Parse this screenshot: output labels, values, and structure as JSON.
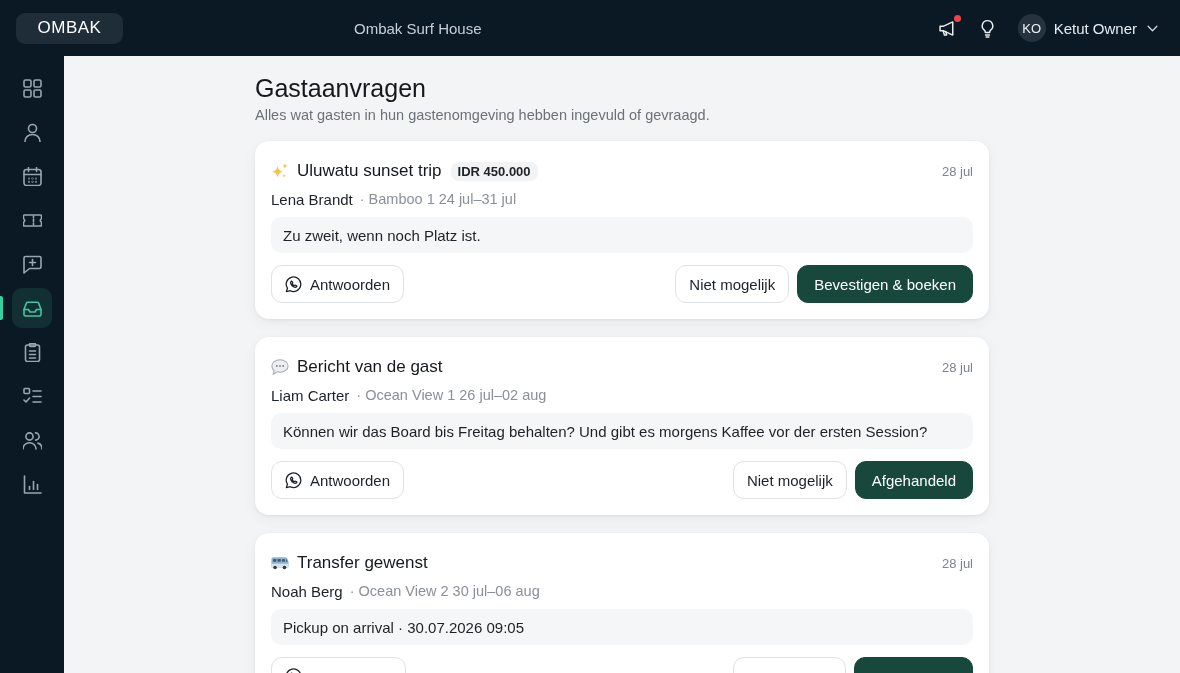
{
  "header": {
    "logo": "OMBAK",
    "property": "Ombak Surf House",
    "notifications_unread": true,
    "user": {
      "initials": "KO",
      "name": "Ketut Owner"
    }
  },
  "sidebar": {
    "items": [
      {
        "selected": false
      },
      {
        "selected": false
      },
      {
        "selected": false
      },
      {
        "selected": false
      },
      {
        "selected": false
      },
      {
        "selected": true
      },
      {
        "selected": false
      },
      {
        "selected": false
      },
      {
        "selected": false
      },
      {
        "selected": false
      }
    ]
  },
  "page": {
    "title": "Gastaanvragen",
    "subtitle": "Alles wat gasten in hun gastenomgeving hebben ingevuld of gevraagd."
  },
  "requests": [
    {
      "kind": "excursion",
      "title": "Uluwatu sunset trip",
      "price": "IDR 450.000",
      "date": "28 jul",
      "guest": "Lena Brandt",
      "details": "· Bamboo 1 24 jul–31 jul",
      "message": "Zu zweit, wenn noch Platz ist.",
      "actions": [
        {
          "kind": "reply",
          "label": "Antwoorden"
        },
        {
          "kind": "decline",
          "label": "Niet mogelijk"
        },
        {
          "kind": "confirm",
          "label": "Bevestigen & boeken"
        }
      ]
    },
    {
      "kind": "message",
      "title": "Bericht van de gast",
      "date": "28 jul",
      "guest": "Liam Carter",
      "details": "· Ocean View 1 26 jul–02 aug",
      "message": "Können wir das Board bis Freitag behalten? Und gibt es morgens Kaffee vor der ersten Session?",
      "actions": [
        {
          "kind": "reply",
          "label": "Antwoorden"
        },
        {
          "kind": "decline",
          "label": "Niet mogelijk"
        },
        {
          "kind": "resolve",
          "label": "Afgehandeld"
        }
      ]
    },
    {
      "kind": "transfer",
      "title": "Transfer gewenst",
      "date": "28 jul",
      "guest": "Noah Berg",
      "details": "· Ocean View 2 30 jul–06 aug",
      "message": "Pickup on arrival · 30.07.2026 09:05",
      "actions": [
        {
          "kind": "reply"
        },
        {
          "kind": "decline"
        },
        {
          "kind": "resolve"
        }
      ]
    }
  ]
}
